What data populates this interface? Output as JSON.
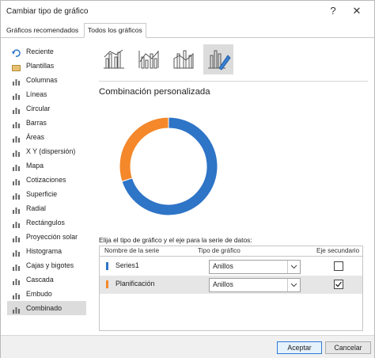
{
  "window": {
    "title": "Cambiar tipo de gráfico",
    "help_glyph": "?",
    "close_glyph": "✕"
  },
  "tabs": [
    {
      "label": "Gráficos recomendados",
      "active": false
    },
    {
      "label": "Todos los gráficos",
      "active": true
    }
  ],
  "sidebar": {
    "items": [
      {
        "label": "Reciente",
        "icon": "recent-icon"
      },
      {
        "label": "Plantillas",
        "icon": "folder-icon"
      },
      {
        "label": "Columnas",
        "icon": "column-chart-icon"
      },
      {
        "label": "Líneas",
        "icon": "line-chart-icon"
      },
      {
        "label": "Circular",
        "icon": "pie-chart-icon"
      },
      {
        "label": "Barras",
        "icon": "bar-chart-icon"
      },
      {
        "label": "Áreas",
        "icon": "area-chart-icon"
      },
      {
        "label": "X Y (dispersión)",
        "icon": "scatter-chart-icon"
      },
      {
        "label": "Mapa",
        "icon": "map-chart-icon"
      },
      {
        "label": "Cotizaciones",
        "icon": "stock-chart-icon"
      },
      {
        "label": "Superficie",
        "icon": "surface-chart-icon"
      },
      {
        "label": "Radial",
        "icon": "radar-chart-icon"
      },
      {
        "label": "Rectángulos",
        "icon": "treemap-icon"
      },
      {
        "label": "Proyección solar",
        "icon": "sunburst-icon"
      },
      {
        "label": "Histograma",
        "icon": "histogram-icon"
      },
      {
        "label": "Cajas y bigotes",
        "icon": "box-whisker-icon"
      },
      {
        "label": "Cascada",
        "icon": "waterfall-icon"
      },
      {
        "label": "Embudo",
        "icon": "funnel-icon"
      },
      {
        "label": "Combinado",
        "icon": "combo-chart-icon",
        "active": true
      }
    ]
  },
  "section_title": "Combinación personalizada",
  "preview": {
    "series_share": [
      0.7,
      0.3
    ],
    "colors": [
      "#2e74c7",
      "#f4882a"
    ]
  },
  "instruction": "Elija el tipo de gráfico y el eje para la serie de datos:",
  "table": {
    "headers": {
      "name": "Nombre de la serie",
      "type": "Tipo de gráfico",
      "secondary": "Eje secundario"
    },
    "rows": [
      {
        "name": "Series1",
        "color": "#2e74c7",
        "type": "Anillos",
        "secondary": false
      },
      {
        "name": "Planificación",
        "color": "#f4882a",
        "type": "Anillos",
        "secondary": true
      }
    ]
  },
  "buttons": {
    "accept": "Aceptar",
    "cancel": "Cancelar"
  }
}
